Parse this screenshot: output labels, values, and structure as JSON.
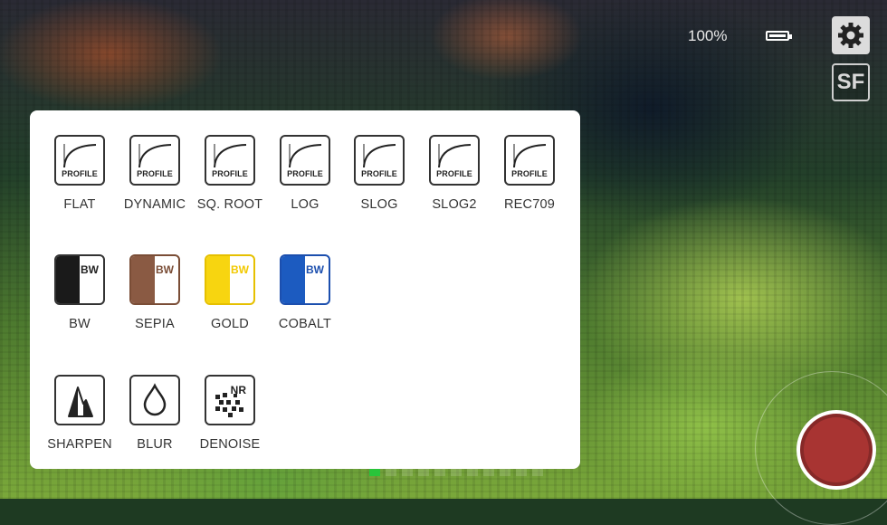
{
  "status": {
    "battery_percent": "100%"
  },
  "topbar": {
    "settings_icon": "gear-icon",
    "sf_label": "SF"
  },
  "panel": {
    "profiles": [
      {
        "label": "FLAT",
        "badge": "PROFILE"
      },
      {
        "label": "DYNAMIC",
        "badge": "PROFILE"
      },
      {
        "label": "SQ. ROOT",
        "badge": "PROFILE"
      },
      {
        "label": "LOG",
        "badge": "PROFILE"
      },
      {
        "label": "SLOG",
        "badge": "PROFILE"
      },
      {
        "label": "SLOG2",
        "badge": "PROFILE"
      },
      {
        "label": "REC709",
        "badge": "PROFILE"
      }
    ],
    "tints": [
      {
        "label": "BW",
        "badge": "BW",
        "color": "#1a1a1a",
        "text_color": "#222222"
      },
      {
        "label": "SEPIA",
        "badge": "BW",
        "color": "#8a5a43",
        "text_color": "#7a4d36"
      },
      {
        "label": "GOLD",
        "badge": "BW",
        "color": "#f7d510",
        "text_color": "#f2c900"
      },
      {
        "label": "COBALT",
        "badge": "BW",
        "color": "#1c5bc0",
        "text_color": "#1c4fae"
      }
    ],
    "filters": [
      {
        "label": "SHARPEN",
        "icon": "sharpen-icon"
      },
      {
        "label": "BLUR",
        "icon": "drop-icon"
      },
      {
        "label": "DENOISE",
        "icon": "denoise-icon",
        "badge": "NR"
      }
    ]
  },
  "colors": {
    "record": "#a83432",
    "page_indicator_active": "#29c43a"
  }
}
